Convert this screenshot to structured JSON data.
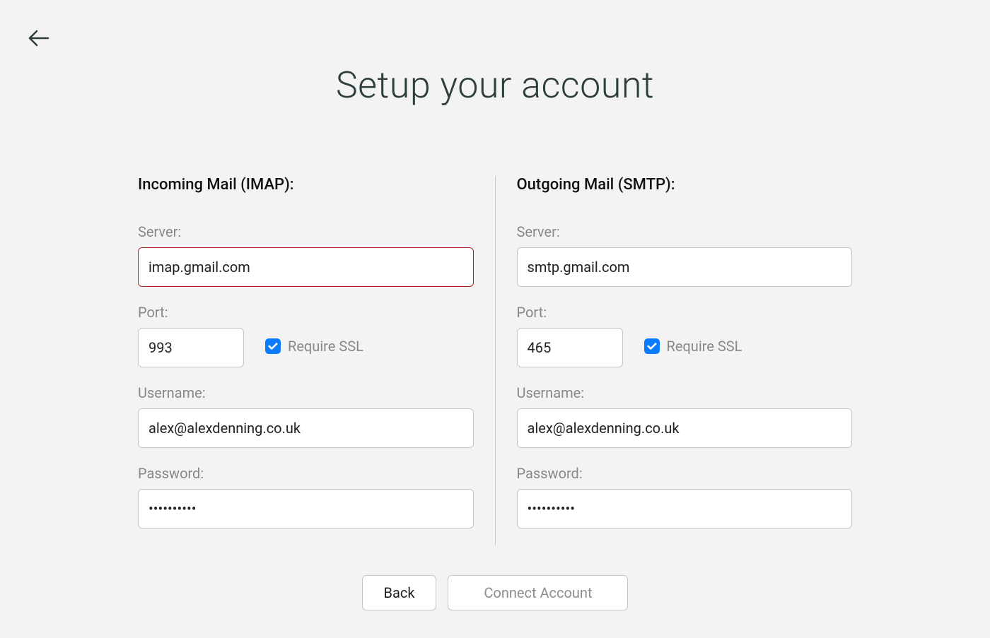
{
  "page": {
    "title": "Setup your account"
  },
  "incoming": {
    "heading": "Incoming Mail (IMAP):",
    "server_label": "Server:",
    "server_value": "imap.gmail.com",
    "port_label": "Port:",
    "port_value": "993",
    "ssl_label": "Require SSL",
    "ssl_checked": true,
    "username_label": "Username:",
    "username_value": "alex@alexdenning.co.uk",
    "password_label": "Password:",
    "password_value": "••••••••••"
  },
  "outgoing": {
    "heading": "Outgoing Mail (SMTP):",
    "server_label": "Server:",
    "server_value": "smtp.gmail.com",
    "port_label": "Port:",
    "port_value": "465",
    "ssl_label": "Require SSL",
    "ssl_checked": true,
    "username_label": "Username:",
    "username_value": "alex@alexdenning.co.uk",
    "password_label": "Password:",
    "password_value": "••••••••••"
  },
  "buttons": {
    "back": "Back",
    "connect": "Connect Account"
  }
}
